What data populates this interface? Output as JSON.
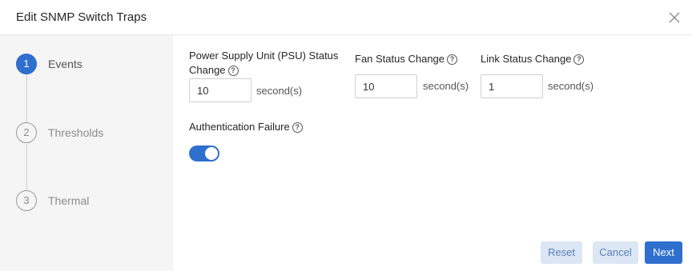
{
  "dialog": {
    "title": "Edit SNMP Switch Traps",
    "close_icon": "close-icon"
  },
  "steps": [
    {
      "number": "1",
      "label": "Events",
      "active": true
    },
    {
      "number": "2",
      "label": "Thresholds",
      "active": false
    },
    {
      "number": "3",
      "label": "Thermal",
      "active": false
    }
  ],
  "fields": {
    "psu": {
      "label_line1": "Power Supply Unit (PSU) Status",
      "label_line2": "Change",
      "value": "10",
      "unit": "second(s)"
    },
    "fan": {
      "label": "Fan Status Change",
      "value": "10",
      "unit": "second(s)"
    },
    "link": {
      "label": "Link Status Change",
      "value": "1",
      "unit": "second(s)"
    },
    "auth": {
      "label": "Authentication Failure",
      "enabled": true
    }
  },
  "help_icon": "?",
  "buttons": {
    "reset": "Reset",
    "cancel": "Cancel",
    "next": "Next"
  },
  "colors": {
    "accent": "#2f6fce",
    "secondary_button_bg": "#dce6f5",
    "sidebar_bg": "#f5f5f5"
  }
}
